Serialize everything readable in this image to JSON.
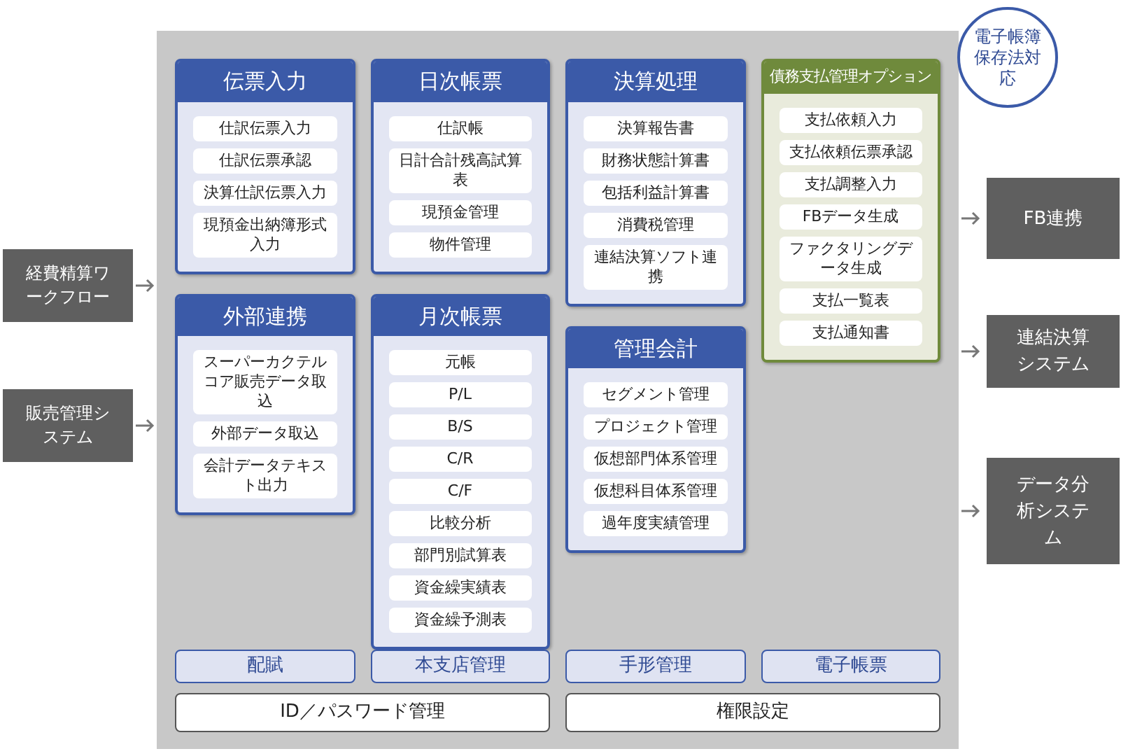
{
  "badge": "電子帳簿保存法対応",
  "inputs": [
    "経費精算ワークフロー",
    "販売管理システム"
  ],
  "columns": [
    [
      {
        "title": "伝票入力",
        "kind": "standard",
        "items": [
          "仕訳伝票入力",
          "仕訳伝票承認",
          "決算仕訳伝票入力",
          "現預金出納簿形式入力"
        ]
      },
      {
        "title": "外部連携",
        "kind": "standard",
        "items": [
          "スーパーカクテルコア販売データ取込",
          "外部データ取込",
          "会計データテキスト出力"
        ]
      }
    ],
    [
      {
        "title": "日次帳票",
        "kind": "standard",
        "items": [
          "仕訳帳",
          "日計合計残高試算表",
          "現預金管理",
          "物件管理"
        ]
      },
      {
        "title": "月次帳票",
        "kind": "standard",
        "items": [
          "元帳",
          "P/L",
          "B/S",
          "C/R",
          "C/F",
          "比較分析",
          "部門別試算表",
          "資金繰実績表",
          "資金繰予測表"
        ]
      }
    ],
    [
      {
        "title": "決算処理",
        "kind": "standard",
        "items": [
          "決算報告書",
          "財務状態計算書",
          "包括利益計算書",
          "消費税管理",
          "連結決算ソフト連携"
        ]
      },
      {
        "title": "管理会計",
        "kind": "standard",
        "items": [
          "セグメント管理",
          "プロジェクト管理",
          "仮想部門体系管理",
          "仮想科目体系管理",
          "過年度実績管理"
        ]
      }
    ],
    [
      {
        "title": "債務支払管理オプション",
        "kind": "option",
        "items": [
          "支払依頼入力",
          "支払依頼伝票承認",
          "支払調整入力",
          "FBデータ生成",
          "ファクタリングデータ生成",
          "支払一覧表",
          "支払通知書"
        ]
      }
    ]
  ],
  "common_features": [
    "配賦",
    "本支店管理",
    "手形管理",
    "電子帳票"
  ],
  "base_features": [
    "ID／パスワード管理",
    "権限設定"
  ],
  "outputs": [
    "FB連携",
    "連結決算システム",
    "データ分析システム"
  ]
}
